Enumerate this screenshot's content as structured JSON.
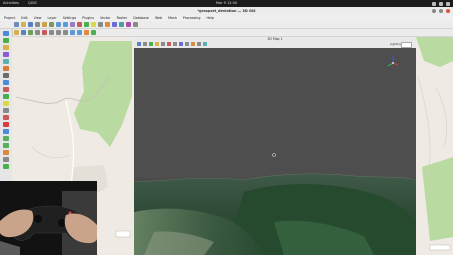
{
  "top_bar": {
    "activities": "Activities",
    "app_name": "QGIS",
    "clock": "Mar 9 12:00"
  },
  "window": {
    "title": "*grosport_deviation — 3D GIS"
  },
  "menubar": {
    "items": [
      "Project",
      "Edit",
      "View",
      "Layer",
      "Settings",
      "Plugins",
      "Vector",
      "Raster",
      "Database",
      "Web",
      "Mesh",
      "Processing",
      "Help"
    ]
  },
  "view3d": {
    "title": "3D Map 1",
    "lighting_label": "Lighting"
  },
  "colors": {
    "map_background": "#efebe4",
    "forest_green": "#b9dba2",
    "sky_gray": "#4e4e4e",
    "terrain_dark": "#2f4a37",
    "axis_x": "#d93a3a",
    "axis_y": "#3cbf4a",
    "axis_z": "#3a58d9"
  },
  "icons": [
    "activities-icon",
    "network-icon",
    "volume-icon",
    "power-icon",
    "axis-gizmo-icon",
    "mouse-cursor-icon"
  ]
}
